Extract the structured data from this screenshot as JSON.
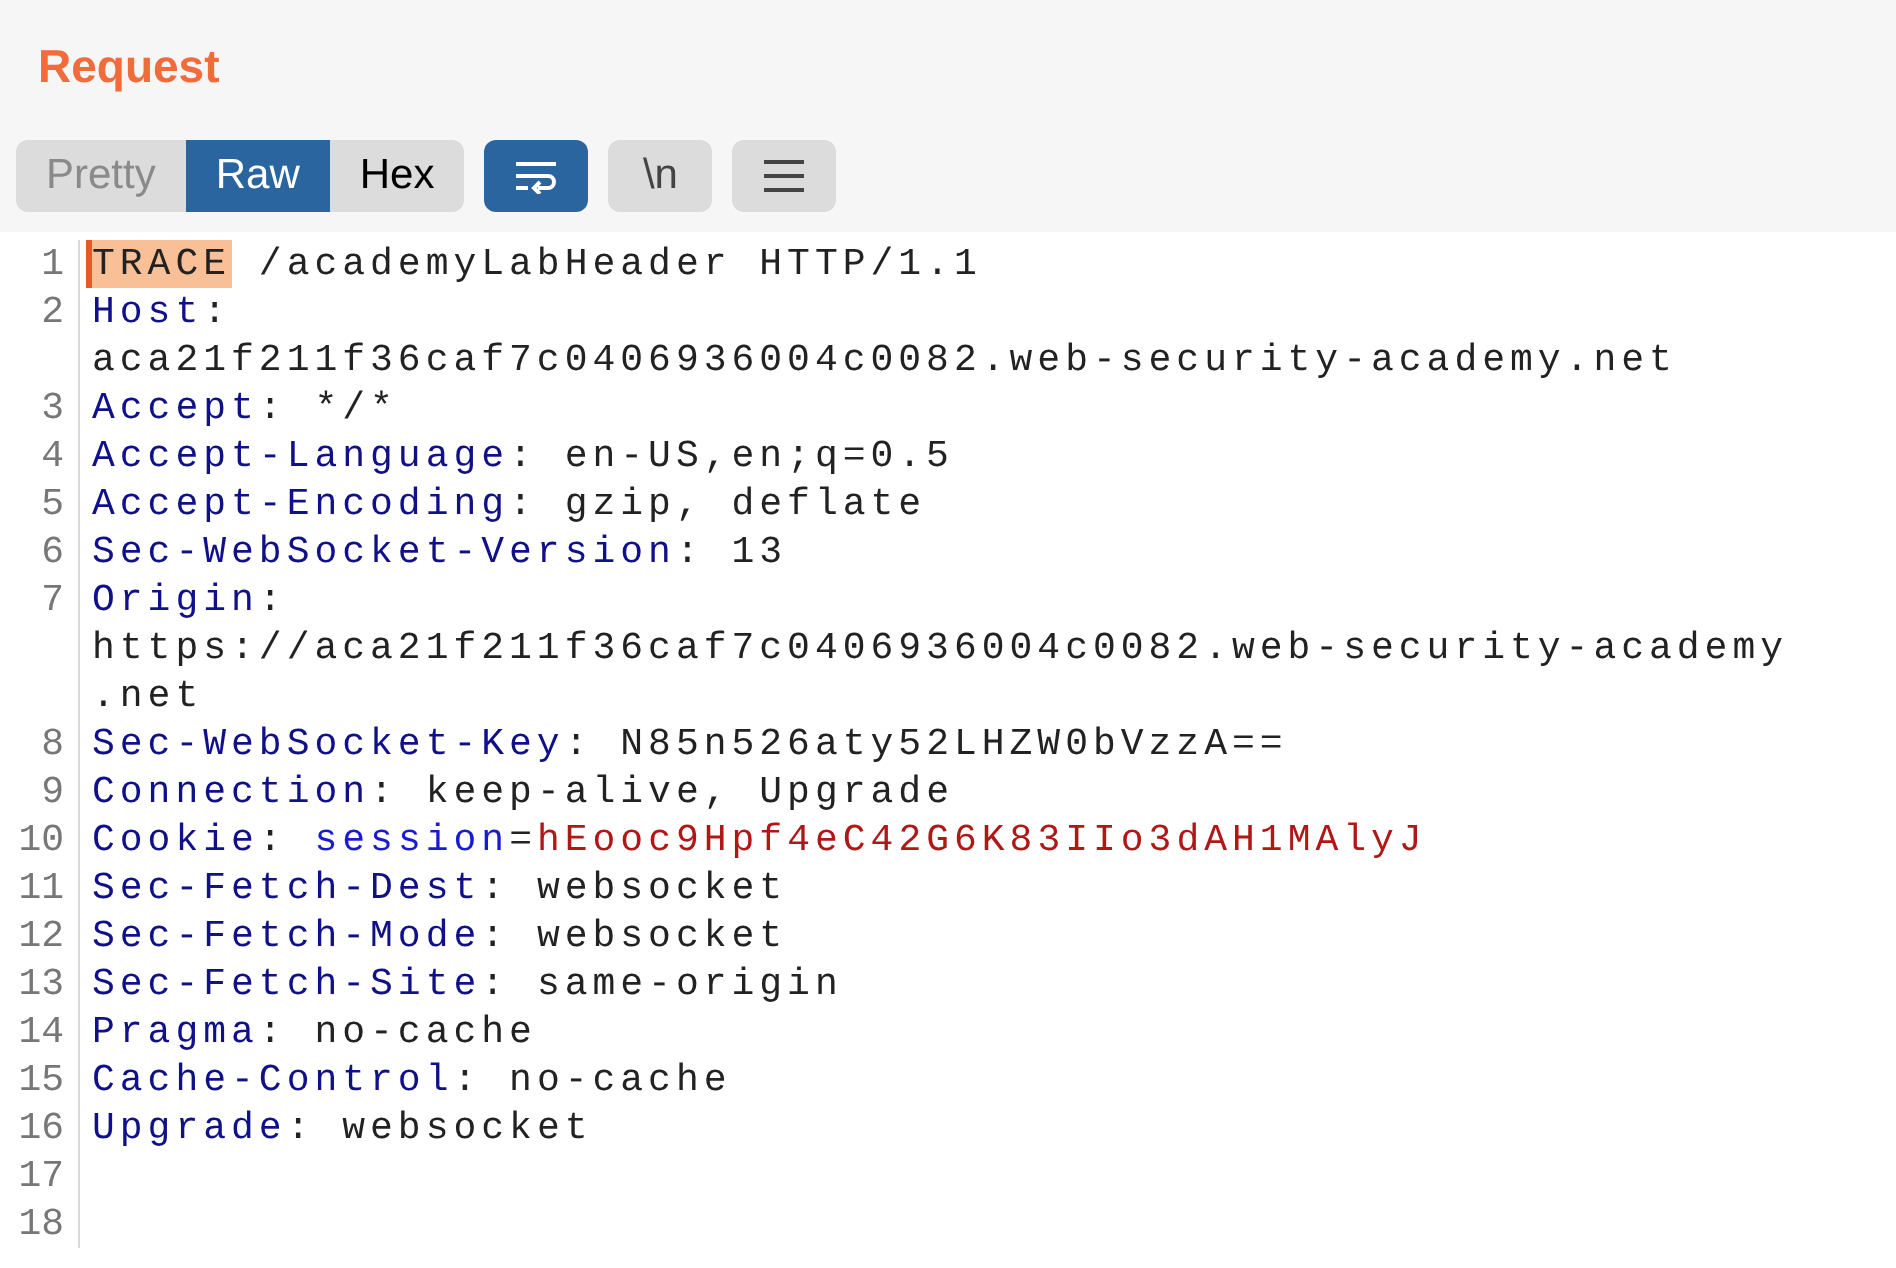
{
  "title": "Request",
  "view_tabs": [
    {
      "label": "Pretty",
      "selected": false,
      "disabled": true
    },
    {
      "label": "Raw",
      "selected": true,
      "disabled": false
    },
    {
      "label": "Hex",
      "selected": false,
      "disabled": false
    }
  ],
  "tool_buttons": [
    {
      "kind": "wrap",
      "on": true
    },
    {
      "kind": "newlines",
      "label": "\\n",
      "on": false
    },
    {
      "kind": "menu",
      "on": false
    }
  ],
  "lines": [
    {
      "number": "1",
      "rows": [
        [
          {
            "kind": "highlight",
            "text": "TRACE"
          },
          {
            "kind": "plain",
            "text": " /academyLabHeader HTTP/1.1"
          }
        ]
      ]
    },
    {
      "number": "2",
      "rows": [
        [
          {
            "kind": "name",
            "text": "Host"
          },
          {
            "kind": "plain",
            "text": ":"
          }
        ],
        [
          {
            "kind": "plain",
            "text": "aca21f211f36caf7c0406936004c0082.web-security-academy.net"
          }
        ]
      ]
    },
    {
      "number": "3",
      "rows": [
        [
          {
            "kind": "name",
            "text": "Accept"
          },
          {
            "kind": "plain",
            "text": ": */*"
          }
        ]
      ]
    },
    {
      "number": "4",
      "rows": [
        [
          {
            "kind": "name",
            "text": "Accept-Language"
          },
          {
            "kind": "plain",
            "text": ": en-US,en;q=0.5"
          }
        ]
      ]
    },
    {
      "number": "5",
      "rows": [
        [
          {
            "kind": "name",
            "text": "Accept-Encoding"
          },
          {
            "kind": "plain",
            "text": ": gzip, deflate"
          }
        ]
      ]
    },
    {
      "number": "6",
      "rows": [
        [
          {
            "kind": "name",
            "text": "Sec-WebSocket-Version"
          },
          {
            "kind": "plain",
            "text": ": 13"
          }
        ]
      ]
    },
    {
      "number": "7",
      "rows": [
        [
          {
            "kind": "name",
            "text": "Origin"
          },
          {
            "kind": "plain",
            "text": ":"
          }
        ],
        [
          {
            "kind": "plain",
            "text": "https://aca21f211f36caf7c0406936004c0082.web-security-academy"
          }
        ],
        [
          {
            "kind": "plain",
            "text": ".net"
          }
        ]
      ]
    },
    {
      "number": "8",
      "rows": [
        [
          {
            "kind": "name",
            "text": "Sec-WebSocket-Key"
          },
          {
            "kind": "plain",
            "text": ": N85n526aty52LHZW0bVzzA=="
          }
        ]
      ]
    },
    {
      "number": "9",
      "rows": [
        [
          {
            "kind": "name",
            "text": "Connection"
          },
          {
            "kind": "plain",
            "text": ": keep-alive, Upgrade"
          }
        ]
      ]
    },
    {
      "number": "10",
      "rows": [
        [
          {
            "kind": "name",
            "text": "Cookie"
          },
          {
            "kind": "plain",
            "text": ": "
          },
          {
            "kind": "param",
            "text": "session"
          },
          {
            "kind": "plain",
            "text": "="
          },
          {
            "kind": "value",
            "text": "hEooc9Hpf4eC42G6K83IIo3dAH1MAlyJ"
          }
        ]
      ]
    },
    {
      "number": "11",
      "rows": [
        [
          {
            "kind": "name",
            "text": "Sec-Fetch-Dest"
          },
          {
            "kind": "plain",
            "text": ": websocket"
          }
        ]
      ]
    },
    {
      "number": "12",
      "rows": [
        [
          {
            "kind": "name",
            "text": "Sec-Fetch-Mode"
          },
          {
            "kind": "plain",
            "text": ": websocket"
          }
        ]
      ]
    },
    {
      "number": "13",
      "rows": [
        [
          {
            "kind": "name",
            "text": "Sec-Fetch-Site"
          },
          {
            "kind": "plain",
            "text": ": same-origin"
          }
        ]
      ]
    },
    {
      "number": "14",
      "rows": [
        [
          {
            "kind": "name",
            "text": "Pragma"
          },
          {
            "kind": "plain",
            "text": ": no-cache"
          }
        ]
      ]
    },
    {
      "number": "15",
      "rows": [
        [
          {
            "kind": "name",
            "text": "Cache-Control"
          },
          {
            "kind": "plain",
            "text": ": no-cache"
          }
        ]
      ]
    },
    {
      "number": "16",
      "rows": [
        [
          {
            "kind": "name",
            "text": "Upgrade"
          },
          {
            "kind": "plain",
            "text": ": websocket"
          }
        ]
      ]
    },
    {
      "number": "17"
    },
    {
      "number": "18"
    }
  ]
}
